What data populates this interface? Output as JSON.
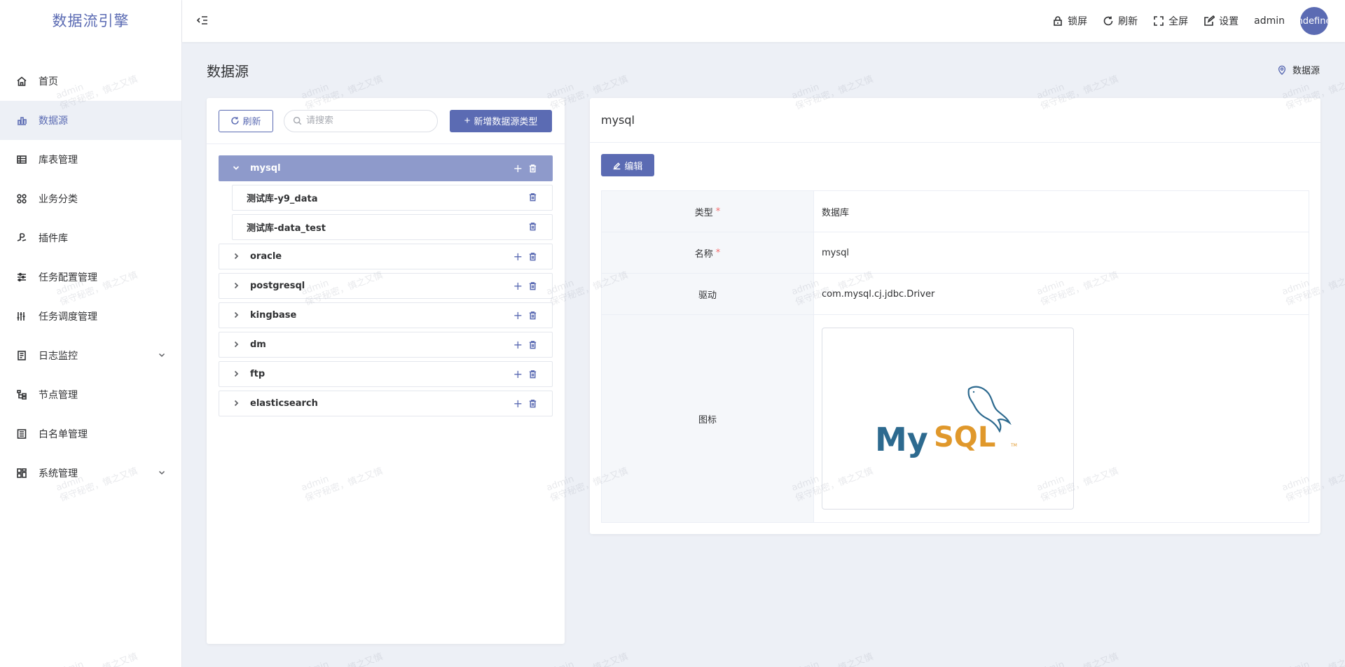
{
  "app": {
    "title": "数据流引擎"
  },
  "sidebar": {
    "items": [
      {
        "label": "首页",
        "icon": "home-icon"
      },
      {
        "label": "数据源",
        "icon": "chart-icon",
        "active": true
      },
      {
        "label": "库表管理",
        "icon": "table-icon"
      },
      {
        "label": "业务分类",
        "icon": "category-icon"
      },
      {
        "label": "插件库",
        "icon": "plugin-icon"
      },
      {
        "label": "任务配置管理",
        "icon": "sliders-icon"
      },
      {
        "label": "任务调度管理",
        "icon": "schedule-icon"
      },
      {
        "label": "日志监控",
        "icon": "log-icon",
        "expandable": true
      },
      {
        "label": "节点管理",
        "icon": "node-icon"
      },
      {
        "label": "白名单管理",
        "icon": "list-icon"
      },
      {
        "label": "系统管理",
        "icon": "system-icon",
        "expandable": true
      }
    ]
  },
  "header": {
    "lock": "锁屏",
    "refresh": "刷新",
    "fullscreen": "全屏",
    "settings": "设置",
    "user": "admin",
    "avatar_text": "undefined"
  },
  "page": {
    "title": "数据源",
    "breadcrumb": "数据源"
  },
  "left_panel": {
    "refresh_label": "刷新",
    "search_placeholder": "请搜索",
    "add_type_label": "新增数据源类型",
    "tree": [
      {
        "label": "mysql",
        "expanded": true,
        "selected": true,
        "children": [
          {
            "label": "测试库-y9_data"
          },
          {
            "label": "测试库-data_test"
          }
        ]
      },
      {
        "label": "oracle"
      },
      {
        "label": "postgresql"
      },
      {
        "label": "kingbase"
      },
      {
        "label": "dm"
      },
      {
        "label": "ftp"
      },
      {
        "label": "elasticsearch"
      }
    ]
  },
  "detail": {
    "title": "mysql",
    "edit_label": "编辑",
    "rows": [
      {
        "label": "类型",
        "required": true,
        "value": "数据库"
      },
      {
        "label": "名称",
        "required": true,
        "value": "mysql"
      },
      {
        "label": "驱动",
        "required": false,
        "value": "com.mysql.cj.jdbc.Driver"
      },
      {
        "label": "图标",
        "required": false,
        "value": ""
      }
    ],
    "logo_text": "MySQL"
  },
  "watermark": {
    "line1": "admin",
    "line2": "保守秘密，慎之又慎"
  },
  "colors": {
    "primary": "#5b6bb3",
    "selected_node": "#8e9acb",
    "required": "#f56c6c",
    "background": "#edf0f6"
  }
}
